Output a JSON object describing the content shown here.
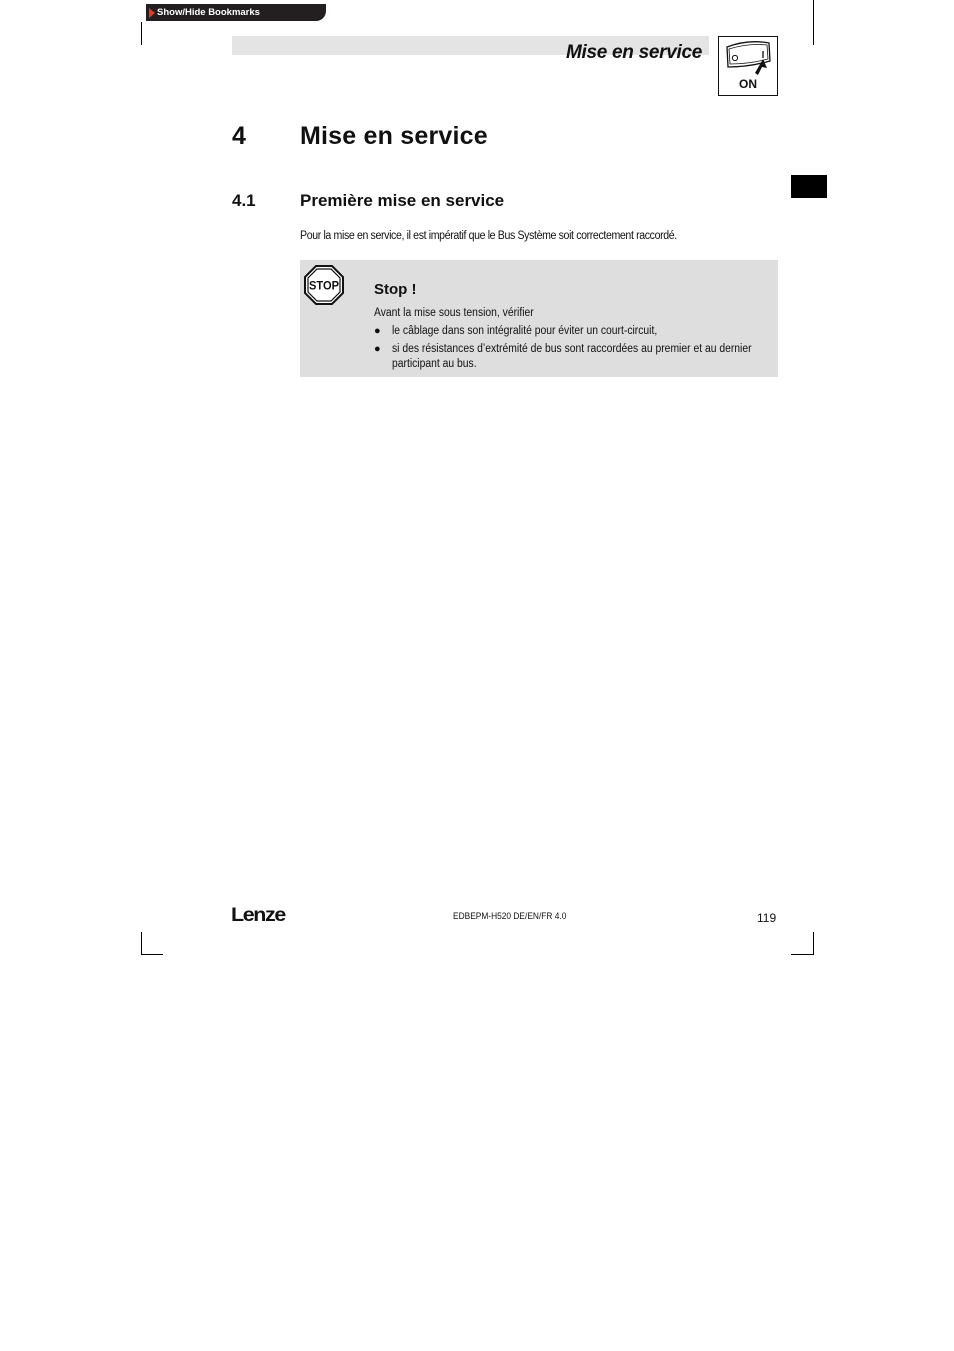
{
  "bookmarks": {
    "label": "Show/Hide Bookmarks",
    "arrow_color": "#e03a2a"
  },
  "header": {
    "title": "Mise en service",
    "icon_label": "ON"
  },
  "chapter": {
    "number": "4",
    "title": "Mise en service"
  },
  "section": {
    "number": "4.1",
    "title": "Première mise en service"
  },
  "intro": "Pour la mise en service, il est impératif que le Bus Système soit correctement raccordé.",
  "stop": {
    "icon_text": "STOP",
    "title": "Stop !",
    "lead": "Avant la mise sous tension, vérifier",
    "items": [
      {
        "bullet": "●",
        "text": "le câblage dans son intégralité pour éviter un court-circuit,"
      },
      {
        "bullet": "●",
        "text": "si des résistances d’extrémité de bus sont raccordées au premier et au dernier participant au bus."
      }
    ]
  },
  "footer": {
    "logo": "Lenze",
    "doc_ref": "EDBEPM-H520 DE/EN/FR 4.0",
    "page_number": "119"
  }
}
